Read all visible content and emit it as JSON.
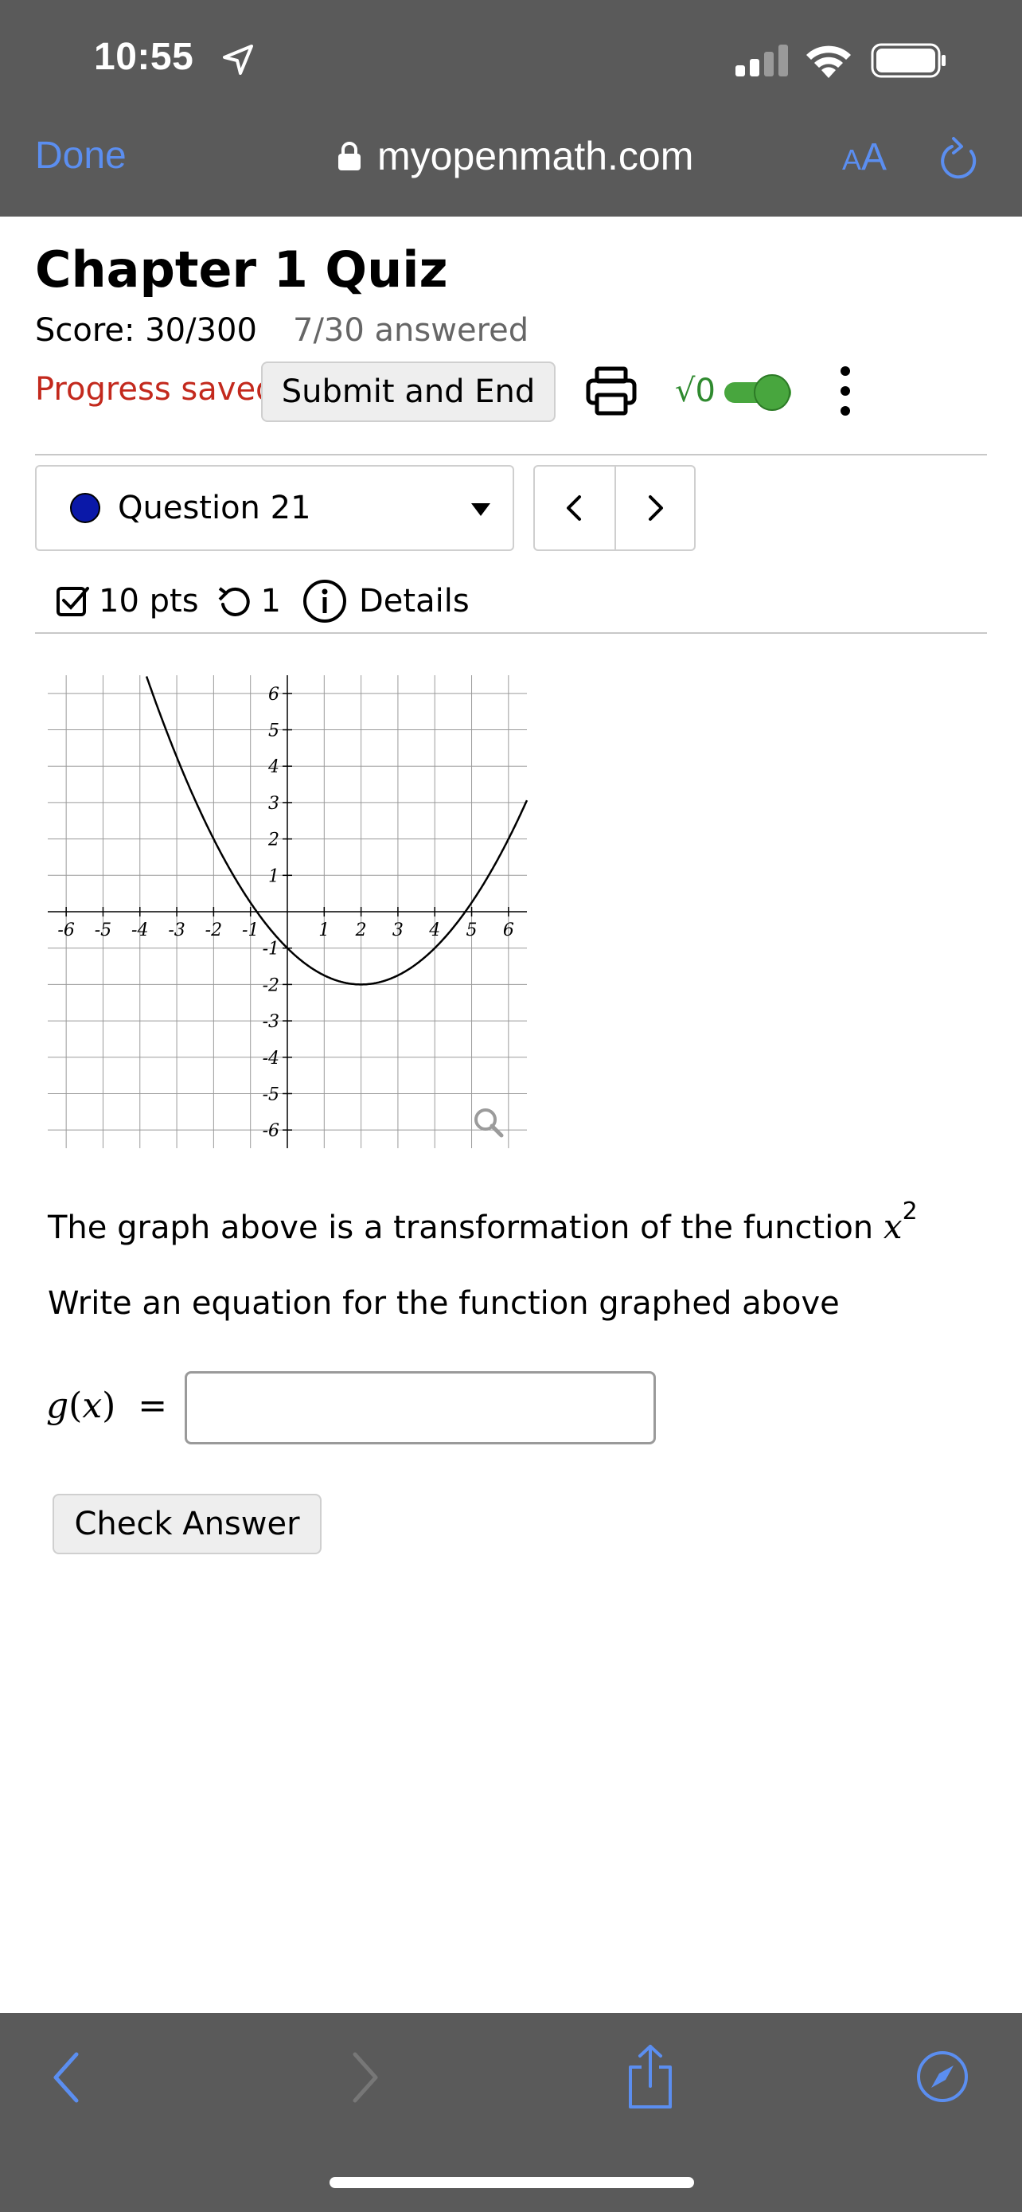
{
  "status_bar": {
    "time": "10:55",
    "icons": [
      "location-arrow-icon",
      "cellular-signal-icon",
      "wifi-icon",
      "battery-icon"
    ]
  },
  "browser": {
    "done_label": "Done",
    "url": "myopenmath.com",
    "text_size_label_small": "A",
    "text_size_label_big": "A",
    "accent_color": "#5b8ef0",
    "bar_color": "#5a5a5a"
  },
  "quiz": {
    "title": "Chapter 1 Quiz",
    "score": "Score: 30/300",
    "answered": "7/30 answered",
    "progress_status": "Progress saved",
    "progress_color": "#c3291d",
    "submit_label": "Submit and End",
    "math_toggle_label": "√0",
    "math_toggle_on": true
  },
  "question": {
    "selected": "Question 21",
    "points": "10 pts",
    "retries": "1",
    "details_label": "Details",
    "prev_label": "<",
    "next_label": ">"
  },
  "graph": {
    "function": "(x-2)^2/4 - 2",
    "xlim": [
      -6.5,
      6.5
    ],
    "ylim": [
      -6.5,
      6.5
    ],
    "x_ticks": [
      "-6",
      "-5",
      "-4",
      "-3",
      "-2",
      "-1",
      "1",
      "2",
      "3",
      "4",
      "5",
      "6"
    ],
    "y_ticks": [
      "6",
      "5",
      "4",
      "3",
      "2",
      "1",
      "-1",
      "-2",
      "-3",
      "-4",
      "-5",
      "-6"
    ],
    "grid": true,
    "zoom_icon": "magnifier-icon"
  },
  "problem": {
    "text_prefix": "The graph above is a transformation of the function ",
    "function_base": "x",
    "function_exp": "2",
    "prompt": "Write an equation for the function graphed above",
    "answer_label_fn": "g",
    "answer_label_var": "x",
    "answer_value": "",
    "check_label": "Check Answer"
  },
  "toolbar": {
    "icons": [
      "back-icon",
      "forward-icon",
      "share-icon",
      "compass-icon"
    ]
  }
}
